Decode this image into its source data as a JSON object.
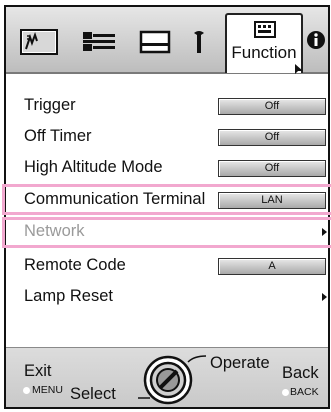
{
  "tabs": [
    {
      "name": "picture",
      "icon": "image-adjust-icon"
    },
    {
      "name": "input",
      "icon": "sliders-icon"
    },
    {
      "name": "screen",
      "icon": "screen-icon"
    },
    {
      "name": "setting",
      "icon": "wrench-icon"
    },
    {
      "name": "function",
      "icon": "function-keyboard-icon",
      "label": "Function",
      "active": true
    },
    {
      "name": "information",
      "icon": "info-icon"
    }
  ],
  "menu": {
    "items": [
      {
        "label": "Trigger",
        "value": "Off",
        "type": "value"
      },
      {
        "label": "Off Timer",
        "value": "Off",
        "type": "value"
      },
      {
        "label": "High Altitude Mode",
        "value": "Off",
        "type": "value"
      },
      {
        "label": "Communication Terminal",
        "value": "LAN",
        "type": "value",
        "highlighted": true
      },
      {
        "label": "Network",
        "type": "submenu",
        "disabled": true,
        "highlighted": true
      },
      {
        "label": "Remote Code",
        "value": "A",
        "type": "value"
      },
      {
        "label": "Lamp Reset",
        "type": "submenu"
      }
    ]
  },
  "footer": {
    "exit": "Exit",
    "menu": "MENU",
    "select": "Select",
    "operate": "Operate",
    "back": "Back",
    "back_key": "BACK"
  },
  "colors": {
    "highlight": "#f2a8cf",
    "disabled_text": "#9a9a9a",
    "tabbar_top": "#e6e6e6",
    "tabbar_bottom": "#bdbdbd"
  }
}
